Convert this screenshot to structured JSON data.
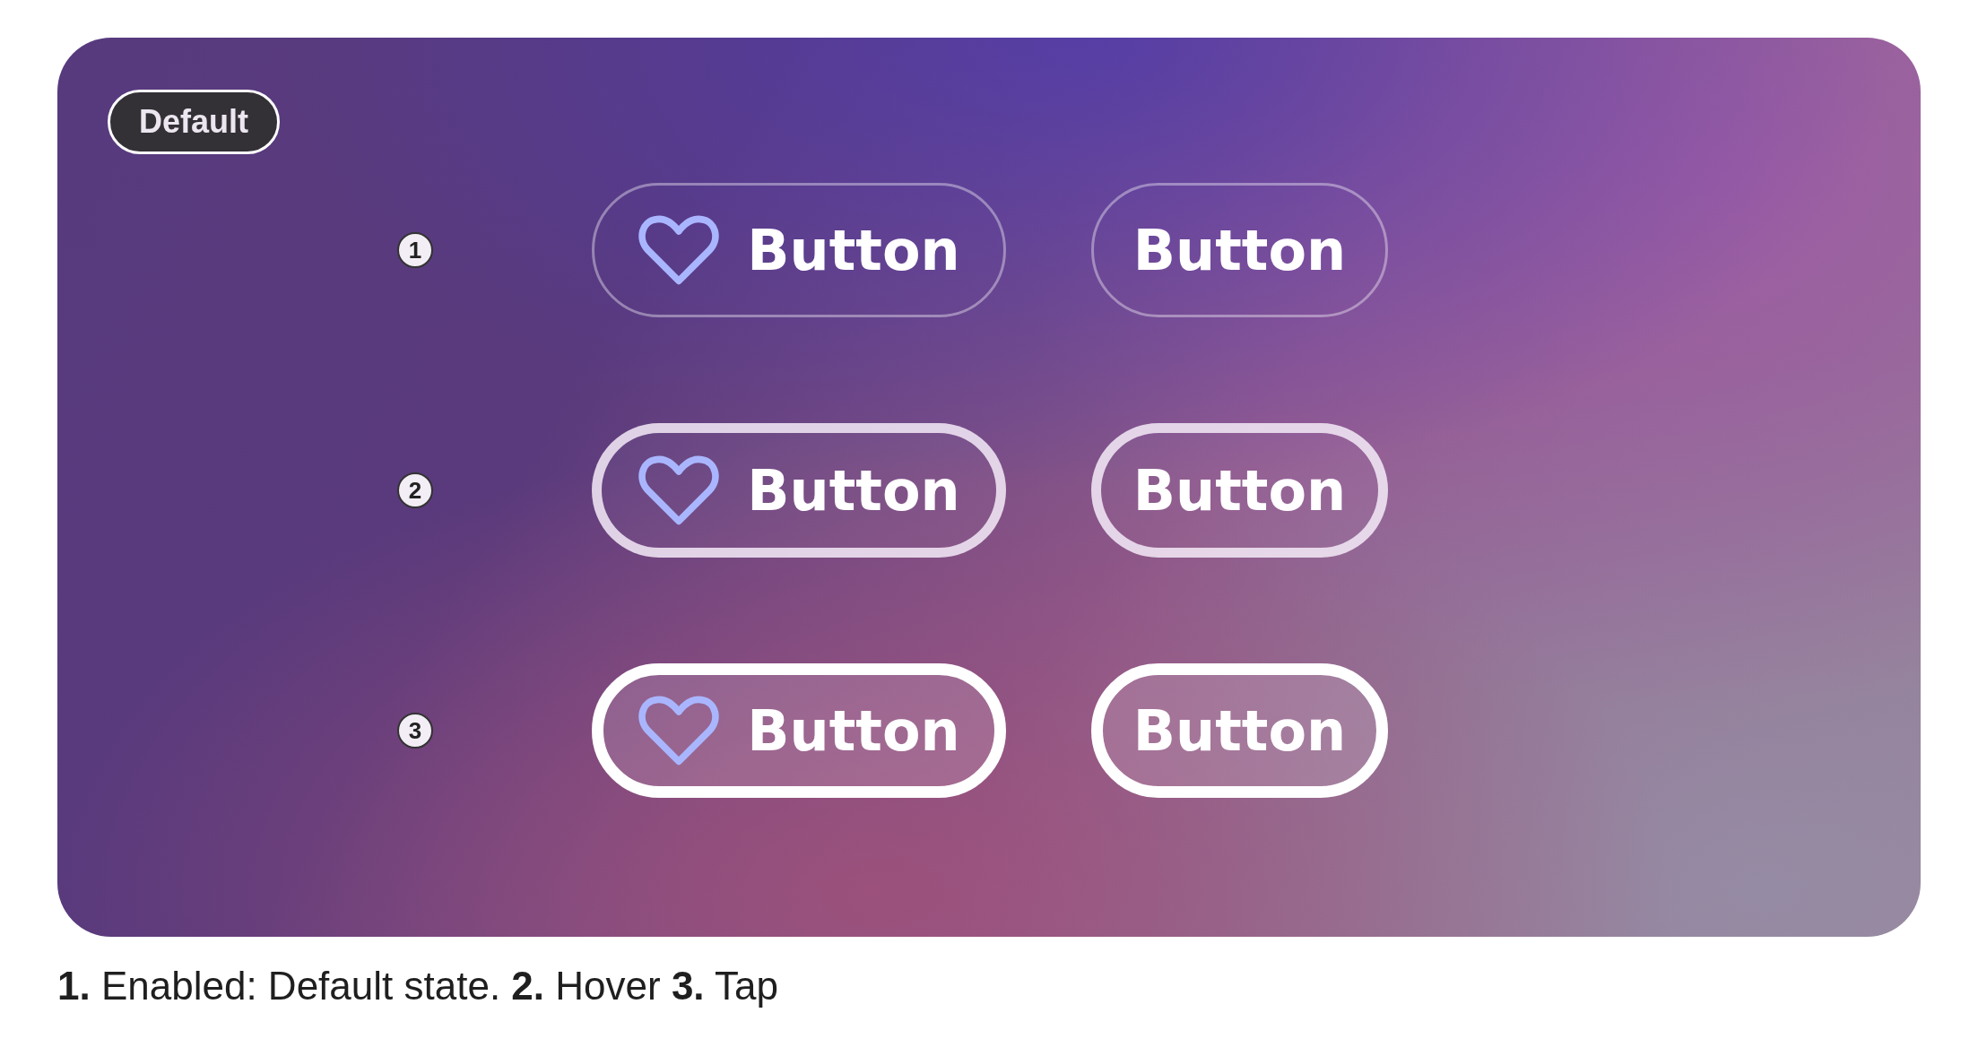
{
  "badge": "Default",
  "rows": [
    {
      "number": "1",
      "kind": "enabled",
      "buttons": [
        {
          "label": "Button",
          "icon": true
        },
        {
          "label": "Button",
          "icon": false
        }
      ]
    },
    {
      "number": "2",
      "kind": "hover",
      "buttons": [
        {
          "label": "Button",
          "icon": true
        },
        {
          "label": "Button",
          "icon": false
        }
      ]
    },
    {
      "number": "3",
      "kind": "tap",
      "buttons": [
        {
          "label": "Button",
          "icon": true
        },
        {
          "label": "Button",
          "icon": false
        }
      ]
    }
  ],
  "caption": "**1.** Enabled: Default state. **2.** Hover **3.** Tap"
}
